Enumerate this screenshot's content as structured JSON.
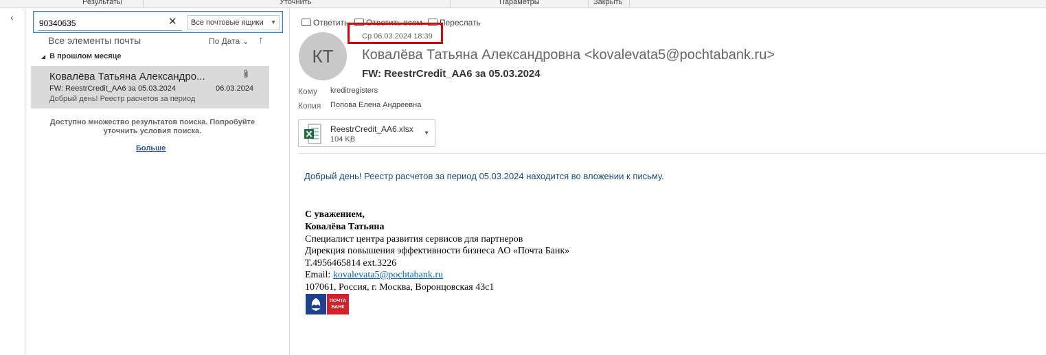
{
  "ribbon": {
    "groups": [
      "Результаты",
      "Уточнить",
      "Параметры",
      "Закрыть"
    ]
  },
  "search": {
    "query": "90340635",
    "scope": "Все почтовые ящики"
  },
  "list": {
    "title": "Все элементы почты",
    "sort_by": "По Дата",
    "group": "В прошлом месяце",
    "messages": [
      {
        "sender": "Ковалёва Татьяна Александро...",
        "subject": "FW: ReestrCredit_AA6 за 05.03.2024",
        "date": "06.03.2024",
        "preview": "Добрый день! Реестр расчетов за период"
      }
    ],
    "more_note": "Доступно множество результатов поиска. Попробуйте уточнить условия поиска.",
    "more_link": "Больше"
  },
  "reading": {
    "actions": {
      "reply": "Ответить",
      "reply_all": "Ответить всем",
      "forward": "Переслать"
    },
    "sent": "Ср 06.03.2024 18:39",
    "avatar_initials": "КТ",
    "from": "Ковалёва Татьяна Александровна <kovalevata5@pochtabank.ru>",
    "subject": "FW: ReestrCredit_AA6 за 05.03.2024",
    "to_label": "Кому",
    "to": "kreditregisters",
    "cc_label": "Копия",
    "cc": "Попова Елена Андреевна",
    "attachment": {
      "name": "ReestrCredit_AA6.xlsx",
      "size": "104 KB"
    },
    "body": "Добрый день! Реестр расчетов за период 05.03.2024 находится во вложении к письму.",
    "signature": {
      "greeting": "С уважением,",
      "name": "Ковалёва Татьяна",
      "position": "Специалист центра развития сервисов для партнеров",
      "department": "Дирекция повышения эффективности бизнеса АО «Почта Банк»",
      "phone": "T.4956465814 ext.3226",
      "email_label": "Email: ",
      "email": "kovalevata5@pochtabank.ru",
      "address": "107061, Россия, г. Москва, Воронцовская 43с1",
      "logo_text": "ПОЧТА БАНК"
    },
    "colors": {
      "highlight": "#e00000",
      "body_text": "#1f497d",
      "logo_blue": "#1f3f8f",
      "logo_red": "#d3222a"
    }
  }
}
